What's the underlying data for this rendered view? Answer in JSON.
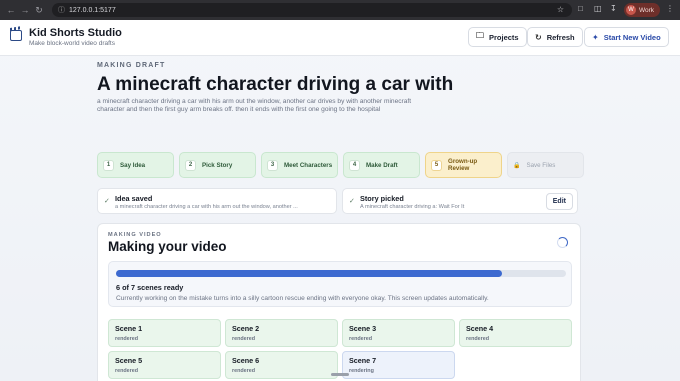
{
  "browser": {
    "url": "127.0.0.1:5177",
    "profile_initial": "W",
    "profile_name": "Work"
  },
  "header": {
    "app_title": "Kid Shorts Studio",
    "app_subtitle": "Make block-world video drafts",
    "buttons": {
      "projects": "Projects",
      "refresh": "Refresh",
      "start_new": "Start New Video"
    }
  },
  "draft": {
    "eyebrow": "MAKING DRAFT",
    "title": "A minecraft character driving a car with",
    "description": "a minecraft character driving a car with his arm out the window, another car drives by with another minecraft character and then the first guy arm breaks off. then it ends with the first one going to the hospital"
  },
  "steps": [
    {
      "num": "1",
      "label": "Say Idea",
      "state": "done"
    },
    {
      "num": "2",
      "label": "Pick Story",
      "state": "done"
    },
    {
      "num": "3",
      "label": "Meet Characters",
      "state": "done"
    },
    {
      "num": "4",
      "label": "Make Draft",
      "state": "done"
    },
    {
      "num": "5",
      "label": "Grown-up Review",
      "state": "current"
    },
    {
      "num": "",
      "label": "Save Files",
      "state": "locked"
    }
  ],
  "summary": {
    "idea_label": "Idea saved",
    "idea_value": "a minecraft character driving a car with his arm out the window, another ...",
    "story_label": "Story picked",
    "story_value": "A minecraft character driving a: Wait For It",
    "edit_label": "Edit"
  },
  "video": {
    "eyebrow": "MAKING VIDEO",
    "title": "Making your video",
    "progress_fraction": 0.857,
    "count_text": "6 of 7 scenes ready",
    "status_message": "Currently working on the mistake turns into a silly cartoon rescue ending with everyone okay. This screen updates automatically.",
    "scenes": [
      {
        "name": "Scene 1",
        "status": "rendered"
      },
      {
        "name": "Scene 2",
        "status": "rendered"
      },
      {
        "name": "Scene 3",
        "status": "rendered"
      },
      {
        "name": "Scene 4",
        "status": "rendered"
      },
      {
        "name": "Scene 5",
        "status": "rendered"
      },
      {
        "name": "Scene 6",
        "status": "rendered"
      },
      {
        "name": "Scene 7",
        "status": "rendering"
      }
    ]
  },
  "icons": {
    "logo": "clapperboard-icon",
    "projects": "folder-icon",
    "refresh": "refresh-icon",
    "start_new": "sparkle-icon"
  },
  "colors": {
    "accent": "#3d6ad0",
    "done_step_bg": "#e3f4e6",
    "review_step_bg": "#fbefcc"
  }
}
